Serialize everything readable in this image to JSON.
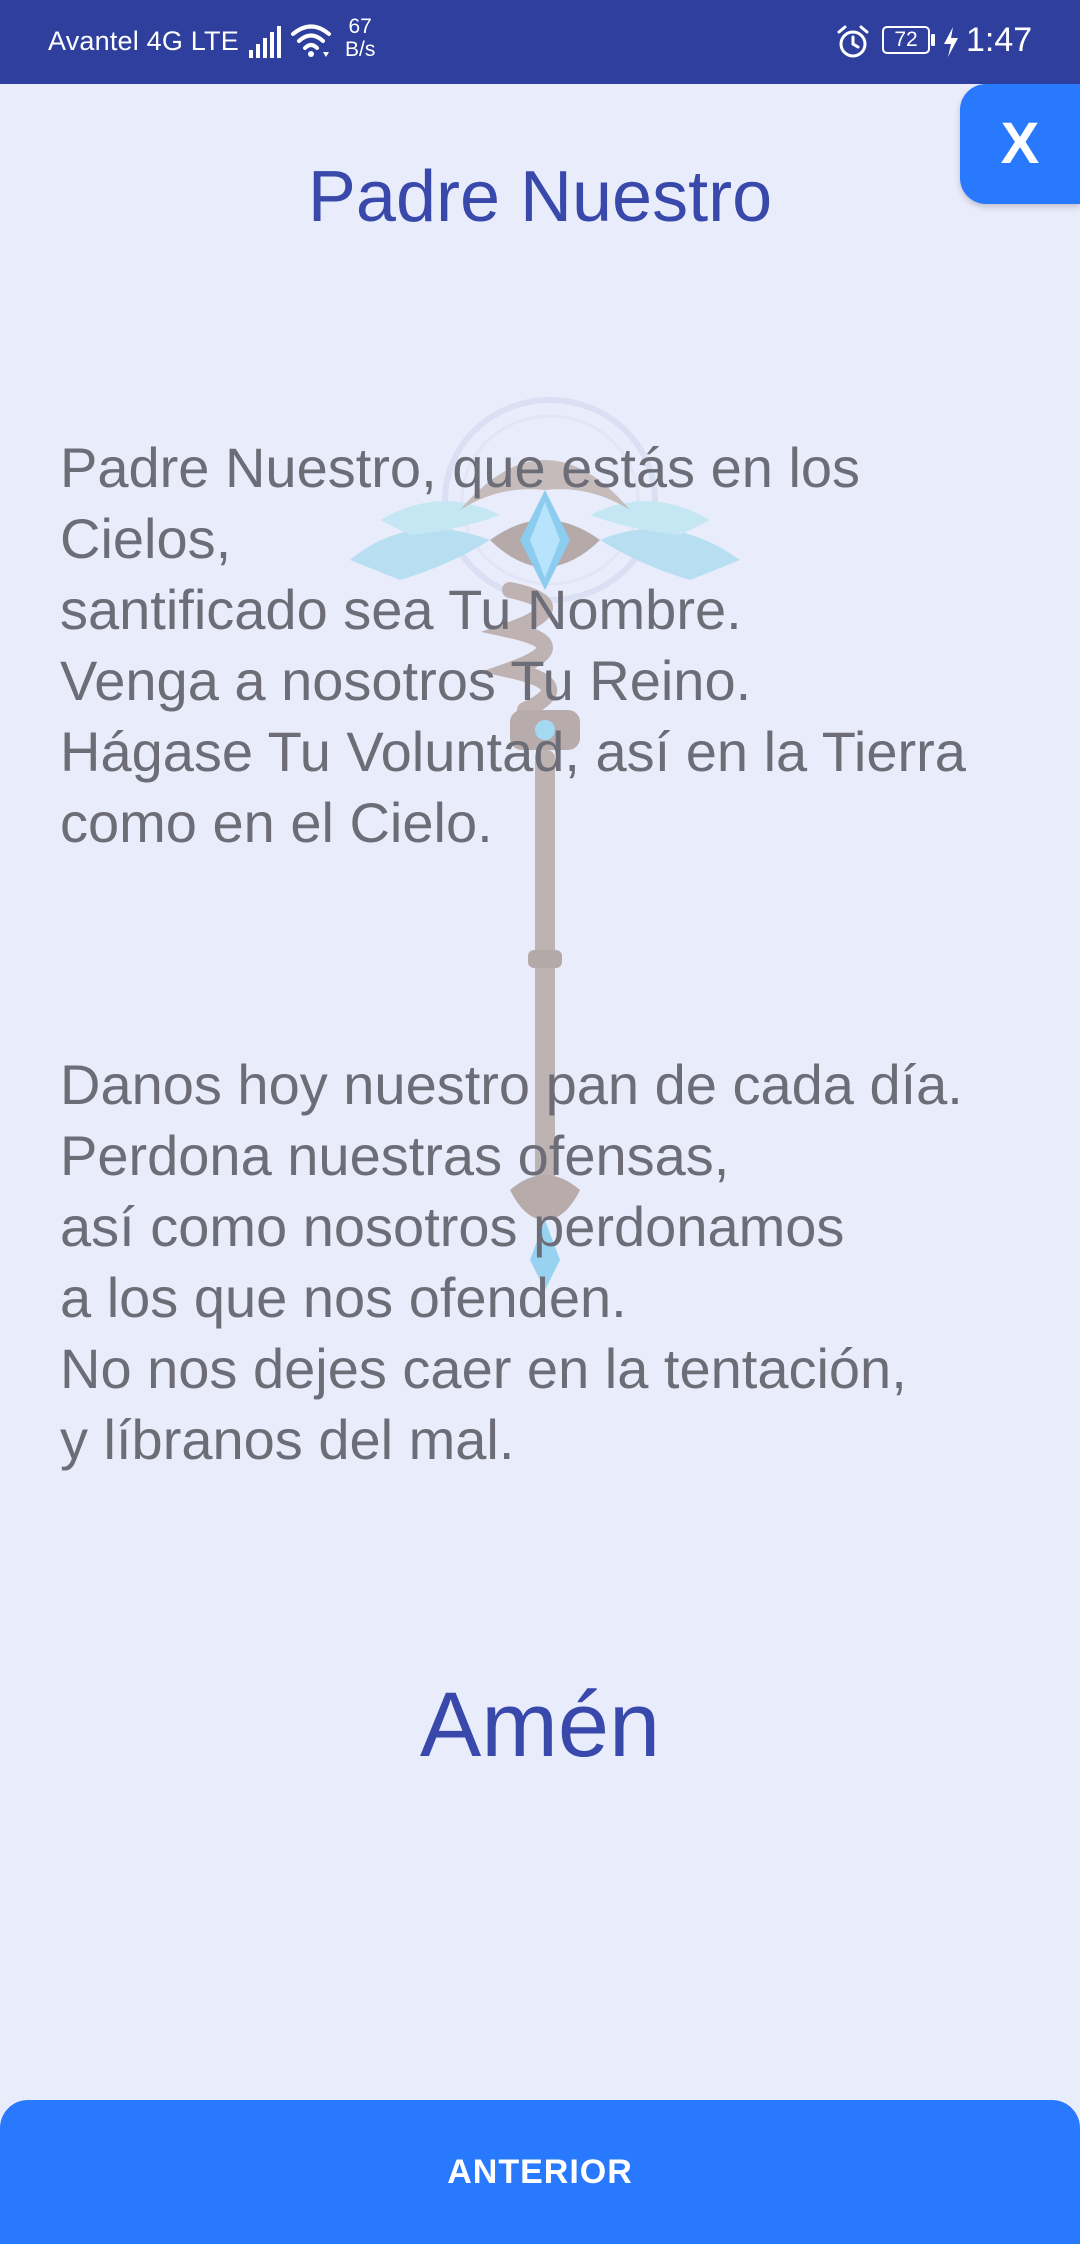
{
  "status_bar": {
    "carrier": "Avantel 4G LTE",
    "net_speed_value": "67",
    "net_speed_unit": "B/s",
    "battery": "72",
    "time": "1:47",
    "color": "#2e3f9e"
  },
  "close_button": {
    "label": "X",
    "color": "#2979ff"
  },
  "title": "Padre Nuestro",
  "prayer": {
    "stanza1": [
      "Padre Nuestro, que estás en los",
      "Cielos,",
      "santificado sea Tu Nombre.",
      "Venga a nosotros Tu Reino.",
      "Hágase Tu Voluntad, así en la Tierra",
      "como en el Cielo."
    ],
    "stanza2": [
      "Danos hoy nuestro pan de cada día.",
      "Perdona nuestras ofensas,",
      "así como nosotros perdonamos",
      "a los que nos ofenden.",
      "No nos dejes caer en la tentación,",
      "y líbranos del mal."
    ]
  },
  "closing": "Amén",
  "bottom_button": {
    "label": "ANTERIOR",
    "color": "#2979ff"
  },
  "background_image": "sceptre-illustration",
  "colors": {
    "background": "#e9ecfb",
    "heading": "#3949ab",
    "body_text": "#6d6d78"
  }
}
